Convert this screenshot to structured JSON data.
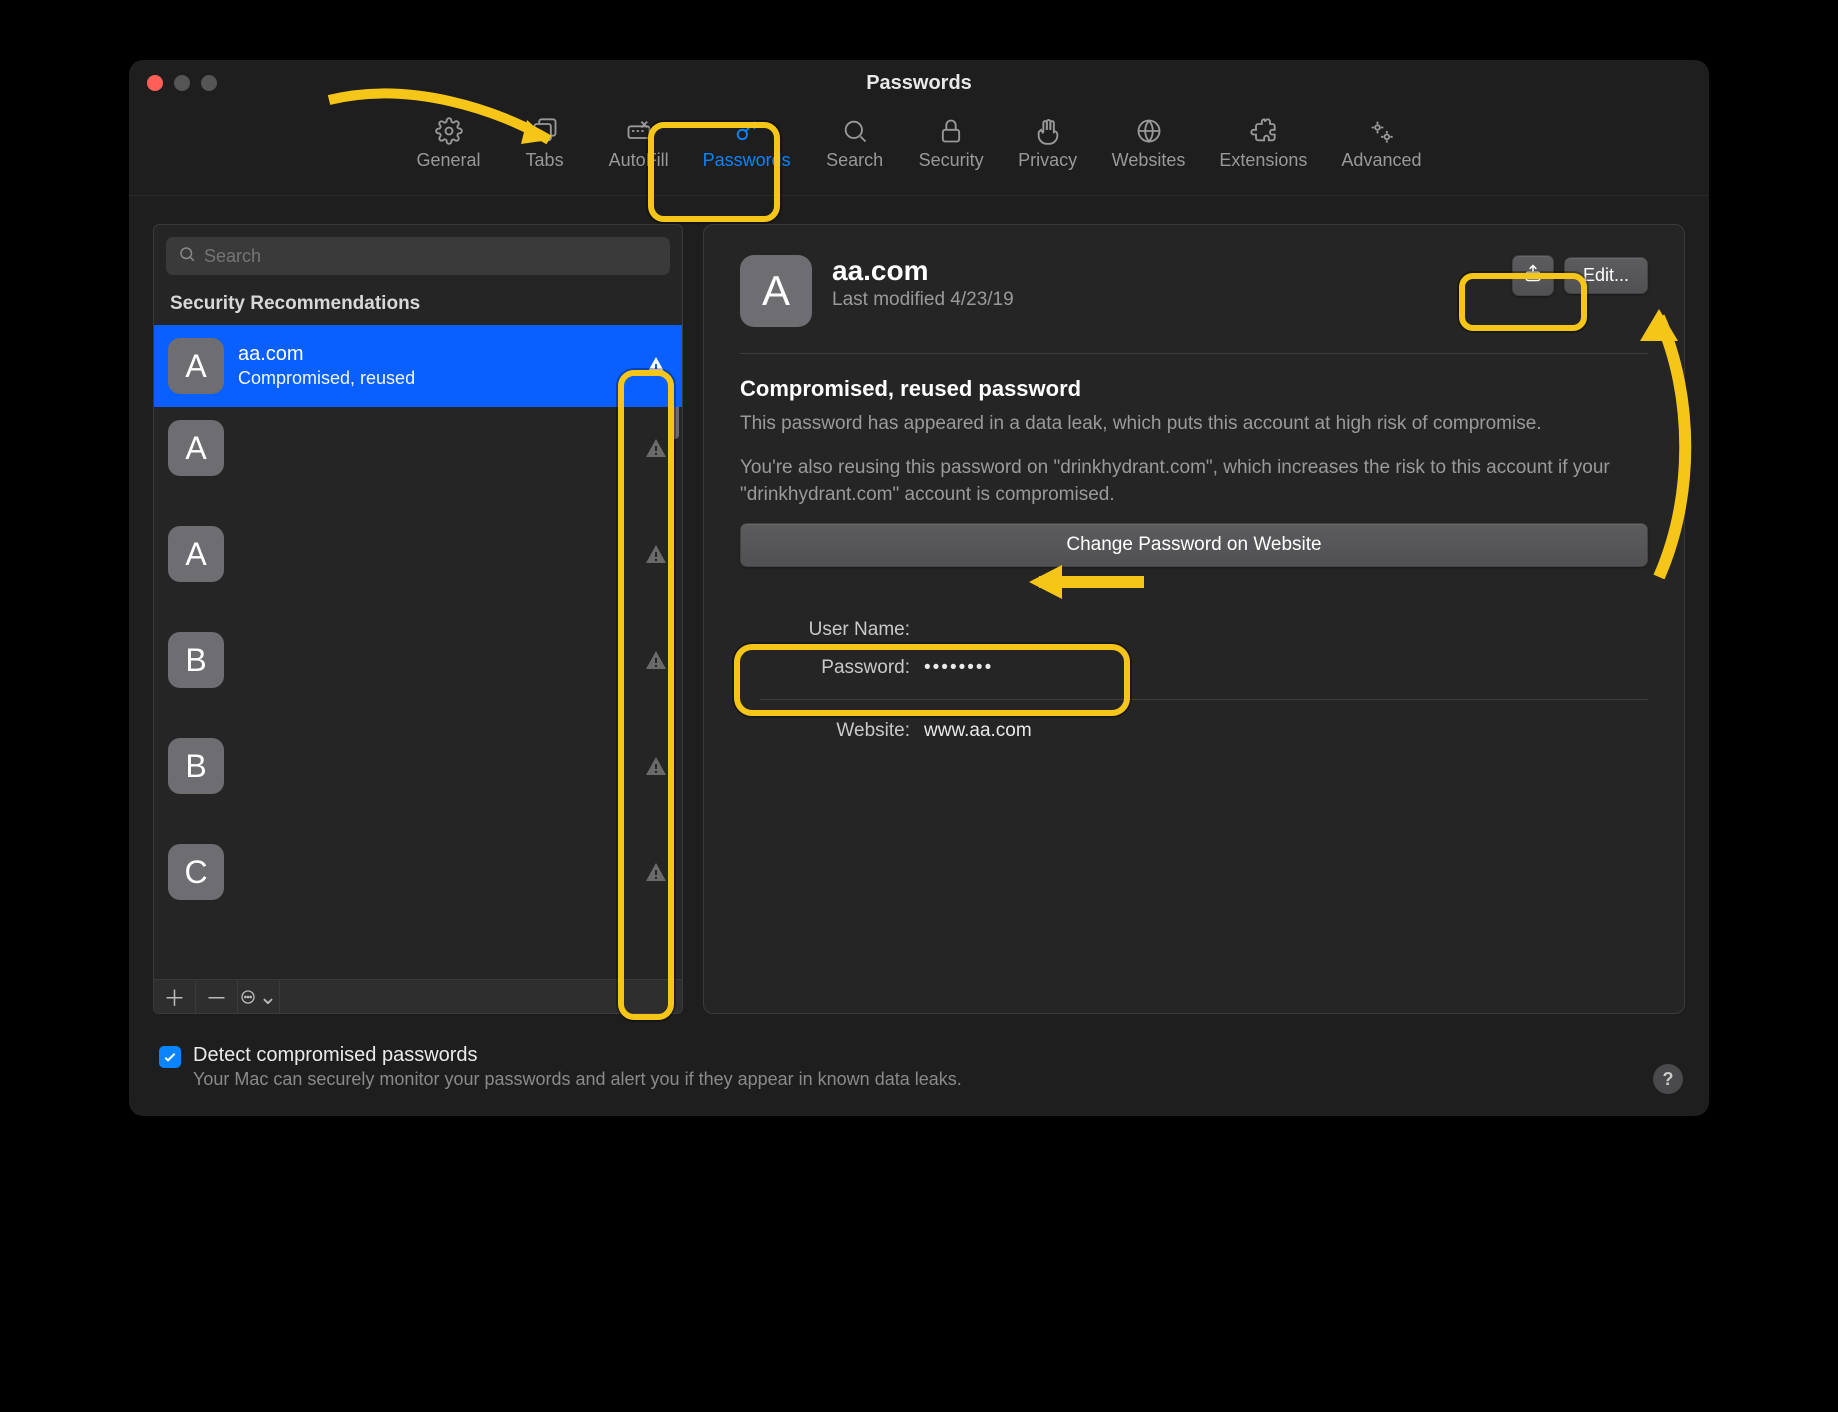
{
  "window": {
    "title": "Passwords"
  },
  "toolbar": {
    "items": [
      {
        "label": "General"
      },
      {
        "label": "Tabs"
      },
      {
        "label": "AutoFill"
      },
      {
        "label": "Passwords"
      },
      {
        "label": "Search"
      },
      {
        "label": "Security"
      },
      {
        "label": "Privacy"
      },
      {
        "label": "Websites"
      },
      {
        "label": "Extensions"
      },
      {
        "label": "Advanced"
      }
    ],
    "active_index": 3
  },
  "search": {
    "placeholder": "Search"
  },
  "sidebar": {
    "section_header": "Security Recommendations",
    "items": [
      {
        "letter": "A",
        "title": "aa.com",
        "subtitle": "Compromised, reused"
      },
      {
        "letter": "A",
        "title": "",
        "subtitle": ""
      },
      {
        "letter": "A",
        "title": "",
        "subtitle": ""
      },
      {
        "letter": "B",
        "title": "",
        "subtitle": ""
      },
      {
        "letter": "B",
        "title": "",
        "subtitle": ""
      },
      {
        "letter": "C",
        "title": "",
        "subtitle": ""
      }
    ],
    "selected_index": 0
  },
  "detail": {
    "avatar_letter": "A",
    "title": "aa.com",
    "last_modified": "Last modified 4/23/19",
    "edit_label": "Edit...",
    "warning_title": "Compromised, reused password",
    "warning_p1": "This password has appeared in a data leak, which puts this account at high risk of compromise.",
    "warning_p2": "You're also reusing this password on \"drinkhydrant.com\", which increases the risk to this account if your \"drinkhydrant.com\" account is compromised.",
    "change_button": "Change Password on Website",
    "fields": {
      "username_label": "User Name:",
      "username_value": "",
      "password_label": "Password:",
      "password_value": "••••••••",
      "website_label": "Website:",
      "website_value": "www.aa.com"
    }
  },
  "footer": {
    "checkbox_label": "Detect compromised passwords",
    "checkbox_sub": "Your Mac can securely monitor your passwords and alert you if they appear in known data leaks.",
    "checked": true
  }
}
